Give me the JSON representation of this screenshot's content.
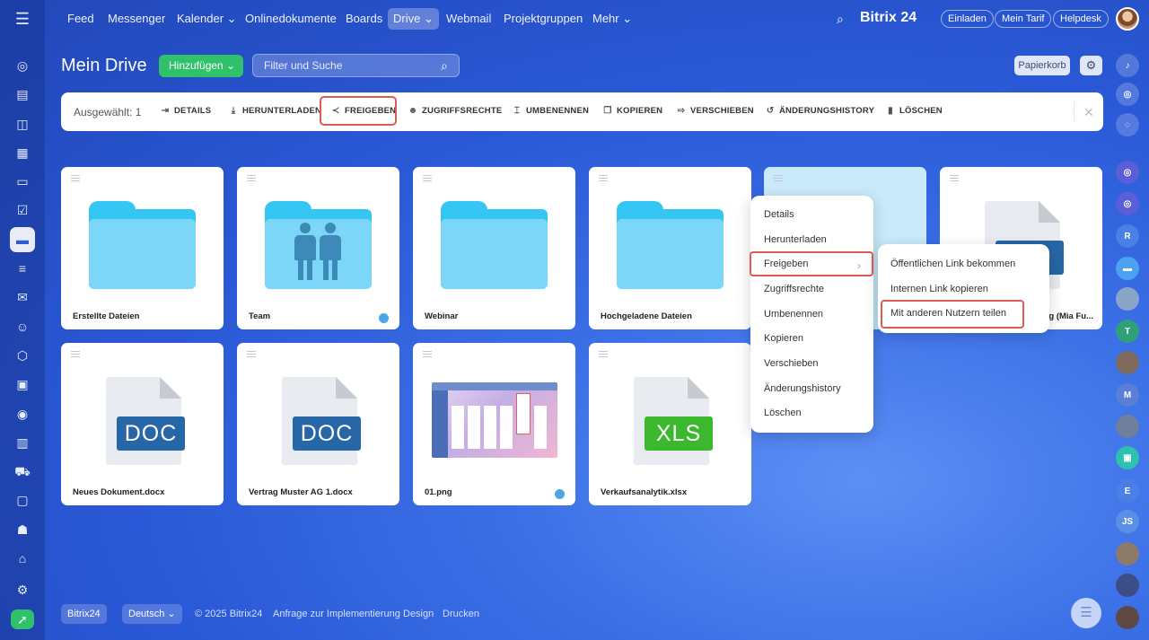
{
  "topbar": {
    "nav": [
      "Feed",
      "Messenger",
      "Kalender ⌄",
      "Onlinedokumente",
      "Boards",
      "Drive ⌄",
      "Webmail",
      "Projektgruppen",
      "Mehr ⌄"
    ],
    "brand": "Bitrix 24",
    "buttons": [
      "Einladen",
      "Mein Tarif",
      "Helpdesk"
    ]
  },
  "header": {
    "title": "Mein Drive",
    "add_label": "Hinzufügen ⌄",
    "filter_placeholder": "Filter und Suche",
    "trash_label": "Papierkorb"
  },
  "toolbar": {
    "selected": "Ausgewählt: 1",
    "items": [
      "DETAILS",
      "HERUNTERLADEN",
      "FREIGEBEN",
      "ZUGRIFFSRECHTE",
      "UMBENENNEN",
      "KOPIEREN",
      "VERSCHIEBEN",
      "ÄNDERUNGSHISTORY",
      "LÖSCHEN"
    ]
  },
  "files": [
    {
      "name": "Erstellte Dateien",
      "type": "folder"
    },
    {
      "name": "Team",
      "type": "folder-shared"
    },
    {
      "name": "Webinar",
      "type": "folder"
    },
    {
      "name": "Hochgeladene Dateien",
      "type": "folder"
    },
    {
      "name": "",
      "type": "folder-selected"
    },
    {
      "name": "g (Mia Fu...",
      "type": "doc-partial"
    },
    {
      "name": "Neues Dokument.docx",
      "type": "doc",
      "badge": "DOC"
    },
    {
      "name": "Vertrag Muster AG 1.docx",
      "type": "doc",
      "badge": "DOC"
    },
    {
      "name": "01.png",
      "type": "image"
    },
    {
      "name": "Verkaufsanalytik.xlsx",
      "type": "xls",
      "badge": "XLS"
    }
  ],
  "context_menu": [
    "Details",
    "Herunterladen",
    "Freigeben",
    "Zugriffsrechte",
    "Umbenennen",
    "Kopieren",
    "Verschieben",
    "Änderungshistory",
    "Löschen"
  ],
  "submenu": [
    "Öffentlichen Link bekommen",
    "Internen Link kopieren",
    "Mit anderen Nutzern teilen"
  ],
  "footer": {
    "brand": "Bitrix24",
    "language": "Deutsch ⌄",
    "links": [
      "© 2025 Bitrix24",
      "Anfrage zur Implementierung",
      "Design",
      "Drucken"
    ]
  },
  "right_rail_initials": [
    "R",
    "T",
    "M",
    "E",
    "JS"
  ],
  "colors": {
    "accent_green": "#2fc26b",
    "highlight_red": "#e05a56",
    "folder_blue": "#35c6f4",
    "doc_blue": "#2766a7",
    "xls_green": "#3cb82f"
  }
}
